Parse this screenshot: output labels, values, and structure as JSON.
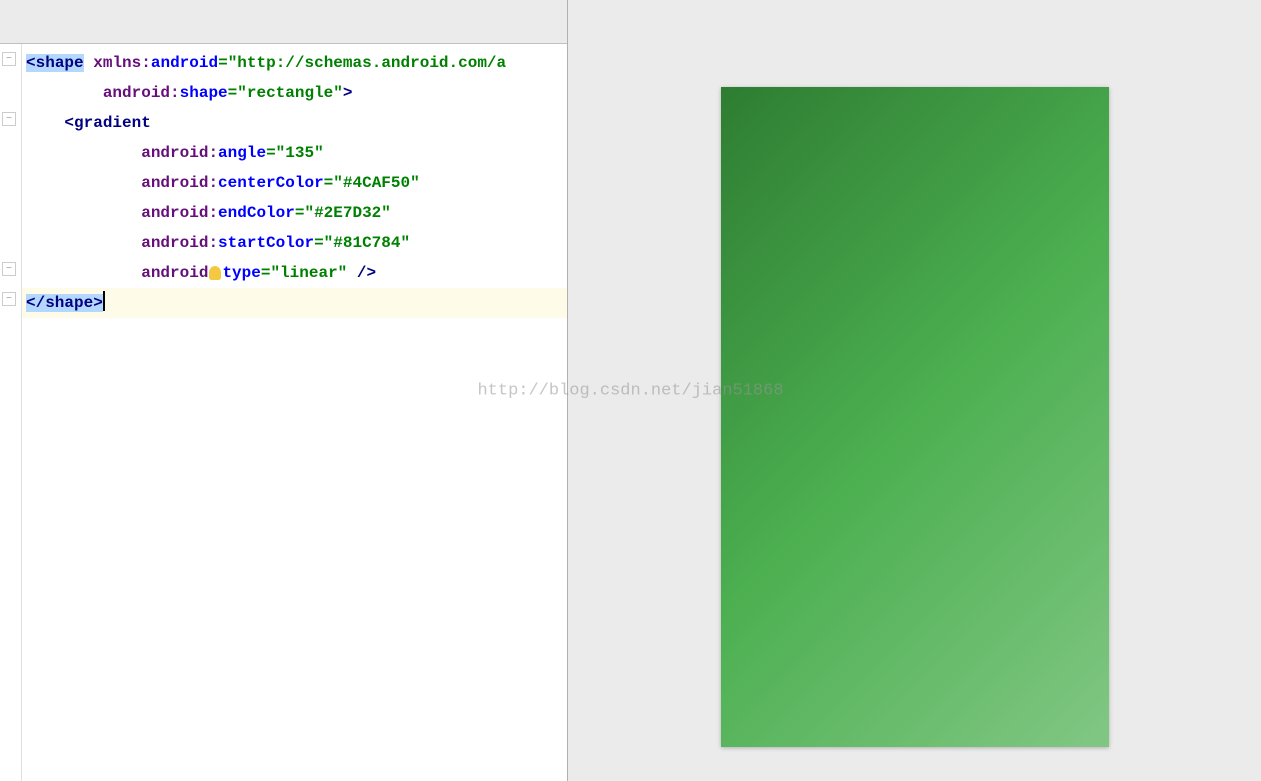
{
  "watermark": "http://blog.csdn.net/jian51868",
  "code": {
    "line1": {
      "tag_open": "<",
      "tag_name": "shape",
      "space": " ",
      "attr1_prefix": "xmlns",
      "attr1_colon": ":",
      "attr1_name": "android",
      "attr1_eq": "=",
      "attr1_val": "\"http://schemas.android.com/a"
    },
    "line2": {
      "indent": "        ",
      "attr_prefix": "android",
      "attr_colon": ":",
      "attr_name": "shape",
      "attr_eq": "=",
      "attr_val": "\"rectangle\"",
      "close": ">"
    },
    "line3": {
      "indent": "    ",
      "tag_open": "<",
      "tag_name": "gradient"
    },
    "line4": {
      "indent": "            ",
      "attr_prefix": "android",
      "attr_colon": ":",
      "attr_name": "angle",
      "attr_eq": "=",
      "attr_val": "\"135\""
    },
    "line5": {
      "indent": "            ",
      "attr_prefix": "android",
      "attr_colon": ":",
      "attr_name": "centerColor",
      "attr_eq": "=",
      "attr_val": "\"#4CAF50\""
    },
    "line6": {
      "indent": "            ",
      "attr_prefix": "android",
      "attr_colon": ":",
      "attr_name": "endColor",
      "attr_eq": "=",
      "attr_val": "\"#2E7D32\""
    },
    "line7": {
      "indent": "            ",
      "attr_prefix": "android",
      "attr_colon": ":",
      "attr_name": "startColor",
      "attr_eq": "=",
      "attr_val": "\"#81C784\""
    },
    "line8": {
      "indent": "            ",
      "attr_prefix": "android",
      "attr_name": "type",
      "attr_eq": "=",
      "attr_val": "\"linear\"",
      "close": " />"
    },
    "line9": {
      "tag_open": "</",
      "tag_name": "shape",
      "tag_close": ">"
    }
  },
  "gradient": {
    "angle": "135",
    "startColor": "#81C784",
    "centerColor": "#4CAF50",
    "endColor": "#2E7D32",
    "type": "linear"
  }
}
